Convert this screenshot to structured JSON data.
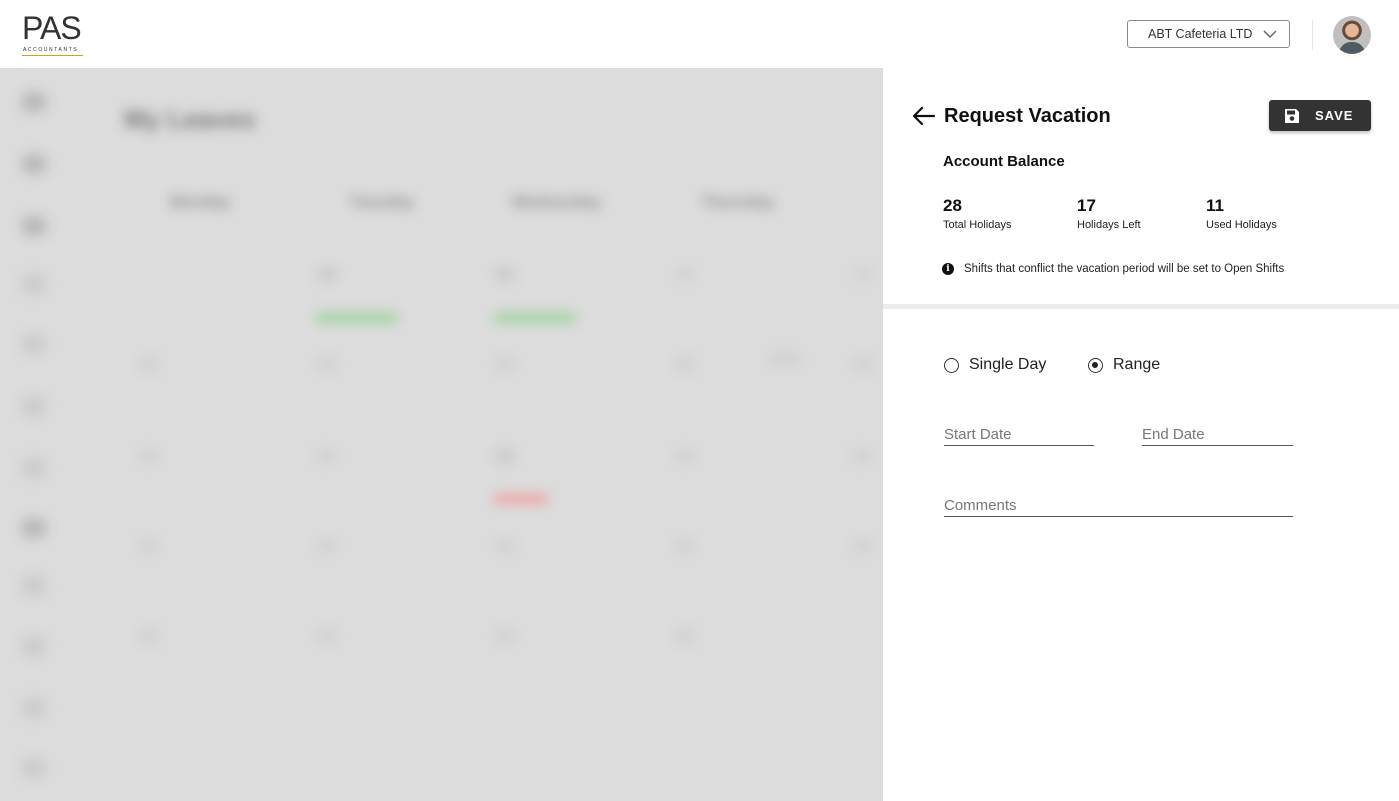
{
  "header": {
    "logo_text": "PAS",
    "logo_subtext": "ACCOUNTANTS",
    "company_selector": "ABT Cafeteria LTD"
  },
  "background": {
    "title": "My Leaves",
    "days": [
      "Monday",
      "Tuesday",
      "Wednesday",
      "Thursday"
    ]
  },
  "panel": {
    "title": "Request Vacation",
    "save_label": "SAVE",
    "balance_title": "Account Balance",
    "stats": [
      {
        "value": "28",
        "label": "Total Holidays"
      },
      {
        "value": "17",
        "label": "Holidays Left"
      },
      {
        "value": "11",
        "label": "Used Holidays"
      }
    ],
    "info_text": "Shifts that conflict the vacation period will be set to Open Shifts",
    "radio_options": [
      {
        "label": "Single Day",
        "checked": false
      },
      {
        "label": "Range",
        "checked": true
      }
    ],
    "start_date_placeholder": "Start Date",
    "end_date_placeholder": "End Date",
    "comments_placeholder": "Comments"
  },
  "icons": {
    "back": "arrow-left-icon",
    "save": "floppy-disk-icon",
    "info": "info-icon",
    "dropdown": "chevron-down-icon"
  }
}
